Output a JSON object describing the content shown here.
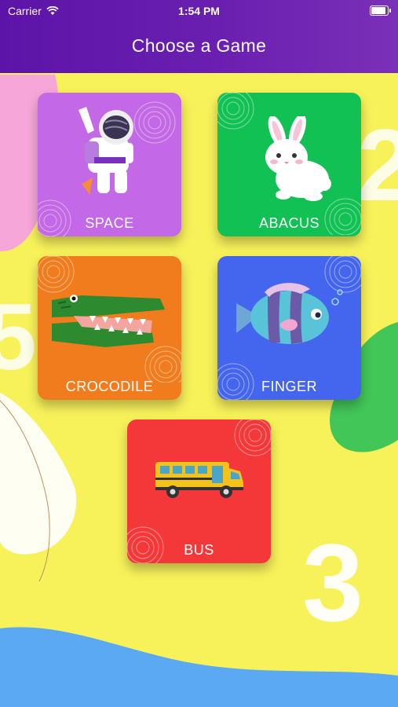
{
  "status": {
    "carrier": "Carrier",
    "time": "1:54 PM"
  },
  "header": {
    "title": "Choose a Game"
  },
  "games": [
    {
      "label": "SPACE",
      "color": "#c368e6",
      "icon": "astronaut-icon"
    },
    {
      "label": "ABACUS",
      "color": "#11c154",
      "icon": "bunny-icon"
    },
    {
      "label": "CROCODILE",
      "color": "#f07c1e",
      "icon": "crocodile-icon"
    },
    {
      "label": "FINGER",
      "color": "#4466ef",
      "icon": "fish-icon"
    },
    {
      "label": "BUS",
      "color": "#f4383a",
      "icon": "bus-icon"
    }
  ],
  "background": {
    "color": "#f7f25a",
    "numbers": [
      "2",
      "5",
      "3"
    ]
  }
}
